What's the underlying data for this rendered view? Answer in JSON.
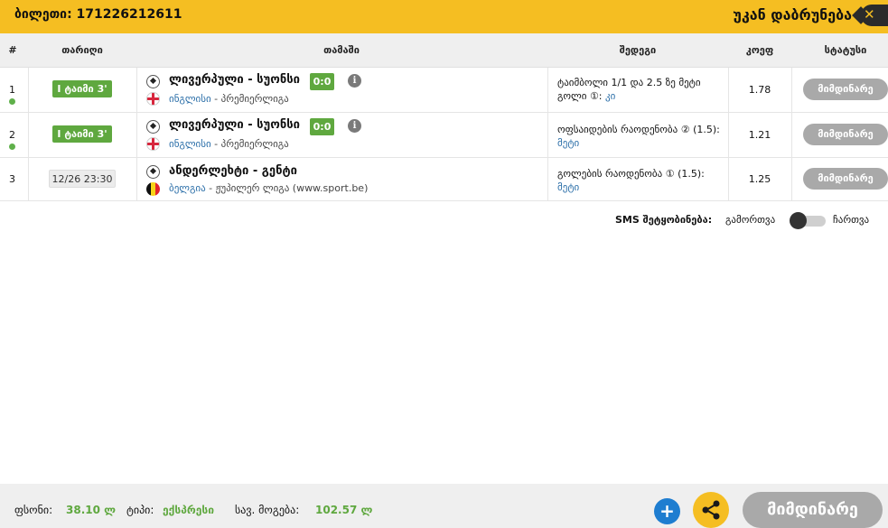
{
  "header": {
    "ticket_label": "ბილეთი: 171226212611",
    "back_label": "უკან დაბრუნება",
    "close_symbol": "✕",
    "accent_color": "#f5be22"
  },
  "columns": {
    "num": "#",
    "date": "თარიღი",
    "game": "თამაში",
    "outcome": "შედეგი",
    "odds": "კოეფ",
    "status": "სტატუსი"
  },
  "rows": [
    {
      "num": "1",
      "live": true,
      "time_badge": "I ტაიმი 3'",
      "match": "ლივერპული - სუონსი",
      "score": "0:0",
      "country": "ინგლისი",
      "league": " - პრემიერლიგა",
      "outcome_text": "ტაიმბოლი 1/1 და 2.5 ზე მეტი გოლი ①: ",
      "outcome_pick": "კი",
      "odds": "1.78",
      "status": "მიმდინარე"
    },
    {
      "num": "2",
      "live": true,
      "time_badge": "I ტაიმი 3'",
      "match": "ლივერპული - სუონსი",
      "score": "0:0",
      "country": "ინგლისი",
      "league": " - პრემიერლიგა",
      "outcome_text": "ოფსაიდების რაოდენობა ② (1.5): ",
      "outcome_pick": "მეტი",
      "odds": "1.21",
      "status": "მიმდინარე"
    },
    {
      "num": "3",
      "live": false,
      "date_badge": "12/26 23:30",
      "match": "ანდერლეხტი - გენტი",
      "country": "ბელგია",
      "league": " - ჟუპილერ ლიგა (www.sport.be)",
      "outcome_text": "გოლების რაოდენობა ① (1.5): ",
      "outcome_pick": "მეტი",
      "odds": "1.25",
      "status": "მიმდინარე"
    }
  ],
  "sms": {
    "label": "SMS შეტყობინება:",
    "off_label": "გამორთვა",
    "on_label": "ჩართვა",
    "enabled": false
  },
  "footer": {
    "stake_label": "ფსონი:",
    "stake_value": "38.10 ლ",
    "type_label": "ტიპი:",
    "type_value": "ექსპრესი",
    "win_label": "სავ. მოგება:",
    "win_value": "102.57 ლ",
    "plus_symbol": "+",
    "status_button": "მიმდინარე"
  }
}
